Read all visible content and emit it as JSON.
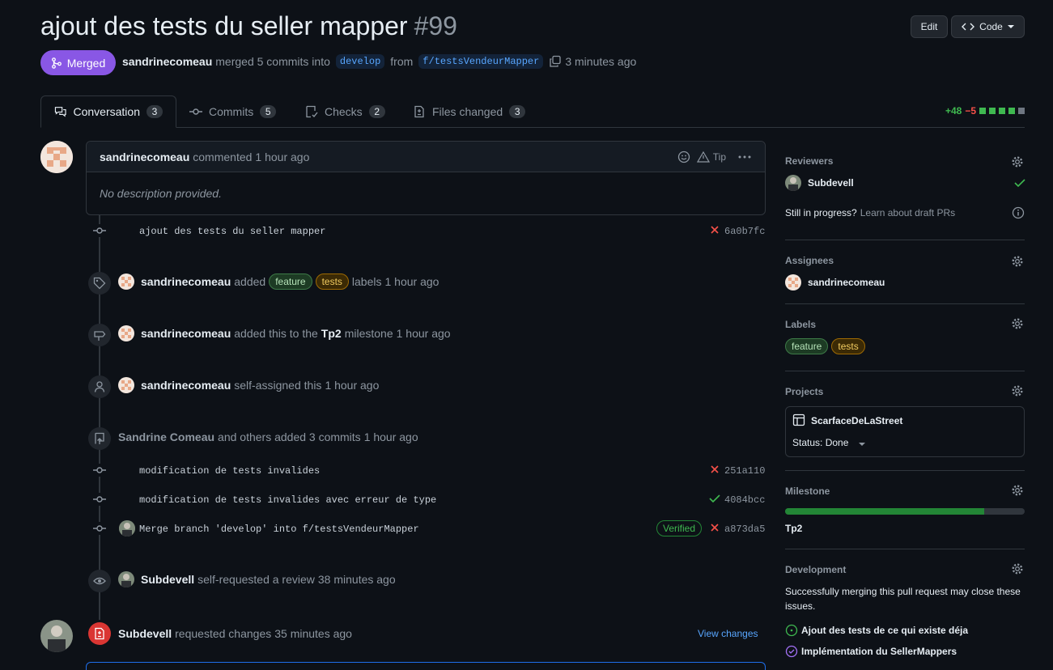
{
  "pr": {
    "title": "ajout des tests du seller mapper",
    "number": "#99",
    "status": "Merged",
    "author": "sandrinecomeau",
    "merge_text": "merged 5 commits into",
    "base_branch": "develop",
    "from_text": "from",
    "head_branch": "f/testsVendeurMapper",
    "time": "3 minutes ago",
    "edit_label": "Edit",
    "code_label": "Code"
  },
  "tabs": [
    {
      "label": "Conversation",
      "count": "3"
    },
    {
      "label": "Commits",
      "count": "5"
    },
    {
      "label": "Checks",
      "count": "2"
    },
    {
      "label": "Files changed",
      "count": "3"
    }
  ],
  "diffstat": {
    "additions": "+48",
    "deletions": "−5"
  },
  "comment": {
    "author": "sandrinecomeau",
    "action": "commented",
    "time": "1 hour ago",
    "tip": "Tip",
    "body": "No description provided."
  },
  "commits_top": [
    {
      "message": "ajout des tests du seller mapper",
      "sha": "6a0b7fc",
      "status": "fail"
    }
  ],
  "events": {
    "labels": {
      "user": "sandrinecomeau",
      "pre": "added",
      "post": "labels",
      "time": "1 hour ago"
    },
    "milestone": {
      "user": "sandrinecomeau",
      "pre": "added this to the",
      "milestone": "Tp2",
      "post": "milestone",
      "time": "1 hour ago"
    },
    "assigned": {
      "user": "sandrinecomeau",
      "text": "self-assigned this",
      "time": "1 hour ago"
    },
    "commits_added": {
      "user": "Sandrine Comeau",
      "text": "and others added 3 commits",
      "time": "1 hour ago"
    },
    "review_req": {
      "user": "Subdevell",
      "text": "self-requested a review",
      "time": "38 minutes ago"
    },
    "changes_req": {
      "user": "Subdevell",
      "text": "requested changes",
      "time": "35 minutes ago",
      "link": "View changes"
    }
  },
  "commits_mid": [
    {
      "message": "modification de tests invalides",
      "sha": "251a110",
      "status": "fail"
    },
    {
      "message": "modification de tests invalides avec erreur de type",
      "sha": "4084bcc",
      "status": "pass"
    },
    {
      "message": "Merge branch 'develop' into f/testsVendeurMapper",
      "sha": "a873da5",
      "status": "fail",
      "verified": "Verified"
    }
  ],
  "labels": [
    {
      "name": "feature",
      "color": "#3d7a47"
    },
    {
      "name": "tests",
      "color": "#9e6a03"
    }
  ],
  "sidebar": {
    "reviewers_h": "Reviewers",
    "reviewer": "Subdevell",
    "draft_q": "Still in progress?",
    "draft_link": "Learn about draft PRs",
    "assignees_h": "Assignees",
    "assignee": "sandrinecomeau",
    "labels_h": "Labels",
    "projects_h": "Projects",
    "project": "ScarfaceDeLaStreet",
    "project_status": "Status: Done",
    "milestone_h": "Milestone",
    "milestone": "Tp2",
    "milestone_progress": 0.83,
    "development_h": "Development",
    "dev_text": "Successfully merging this pull request may close these issues.",
    "issues": [
      {
        "title": "Ajout des tests de ce qui existe déja",
        "state": "open"
      },
      {
        "title": "Implémentation du SellerMappers",
        "state": "closed"
      }
    ]
  }
}
